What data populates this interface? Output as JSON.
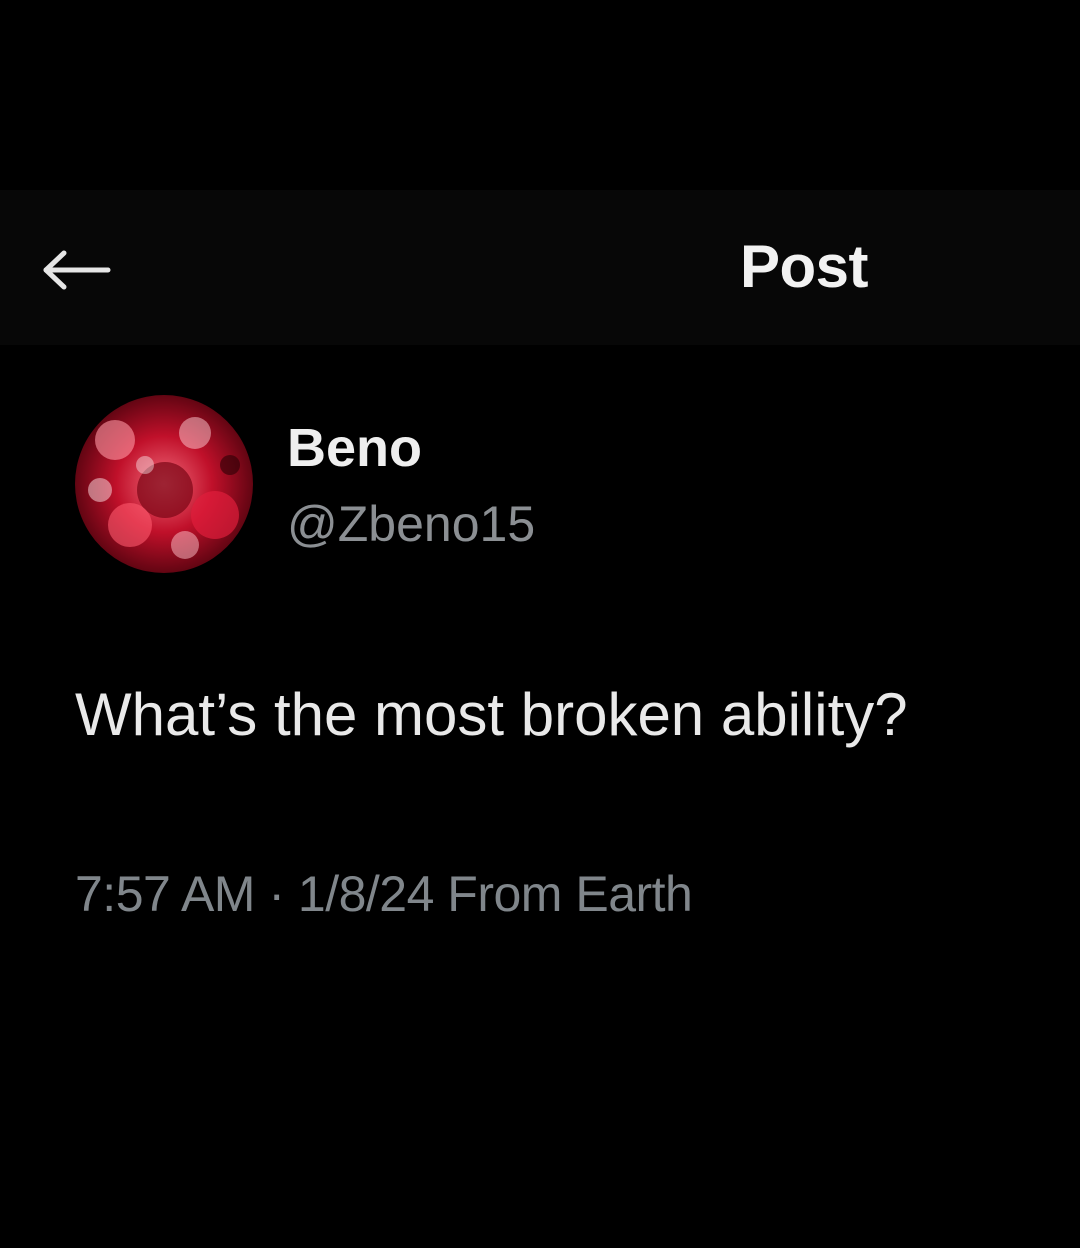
{
  "header": {
    "back_icon": "arrow-left-icon",
    "title": "Post"
  },
  "author": {
    "avatar_icon": "avatar-image",
    "display_name": "Beno",
    "handle": "@Zbeno15"
  },
  "post": {
    "text": "What’s the most broken ability?",
    "time": "7:57 AM",
    "separator": " · ",
    "date": "1/8/24",
    "location": " From Earth"
  },
  "colors": {
    "background": "#000000",
    "header_background": "#070707",
    "primary_text": "#e7e9ea",
    "secondary_text": "#80868b",
    "avatar_accent": "#c0102a"
  }
}
